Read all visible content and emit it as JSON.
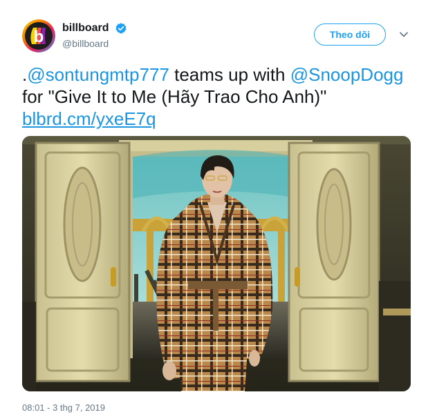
{
  "author": {
    "display_name": "billboard",
    "handle": "@billboard",
    "avatar_letter": "b",
    "avatar_label": "billboard",
    "verified": true
  },
  "follow_button_label": "Theo dõi",
  "tweet": {
    "prefix": ".",
    "mention1": "@sontungmtp777",
    "text1": " teams up with ",
    "mention2": "@SnoopDogg",
    "text2": " for \"Give It to Me (Hãy Trao Cho Anh)\" ",
    "link": "blbrd.cm/yxeE7q"
  },
  "media": {
    "icon": "photo"
  },
  "timestamp": "08:01 - 3 thg 7, 2019",
  "colors": {
    "link": "#1b95e0",
    "follow": "#1da1f2",
    "meta": "#657786"
  }
}
